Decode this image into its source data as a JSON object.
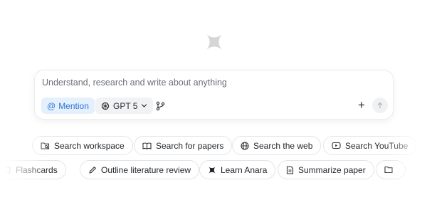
{
  "composer": {
    "placeholder": "Understand, research and write about anything",
    "mention_label": "Mention",
    "model_label": "GPT 5",
    "plus_label": "+"
  },
  "suggestions_row1": [
    {
      "label": "Search workspace",
      "icon": "folder-search-icon"
    },
    {
      "label": "Search for papers",
      "icon": "book-open-icon"
    },
    {
      "label": "Search the web",
      "icon": "globe-icon"
    },
    {
      "label": "Search YouTube",
      "icon": "youtube-icon"
    }
  ],
  "suggestions_row2": [
    {
      "label": "Flashcards",
      "icon": "flashcards-icon"
    },
    {
      "label": "Outline literature review",
      "icon": "pencil-icon"
    },
    {
      "label": "Learn Anara",
      "icon": "anara-logo-icon"
    },
    {
      "label": "Summarize paper",
      "icon": "document-icon"
    },
    {
      "label": "",
      "icon": "folder-icon"
    }
  ],
  "colors": {
    "mention_bg": "#e5f0fd",
    "mention_text": "#2f73d6",
    "logo": "#d6d6d8"
  }
}
